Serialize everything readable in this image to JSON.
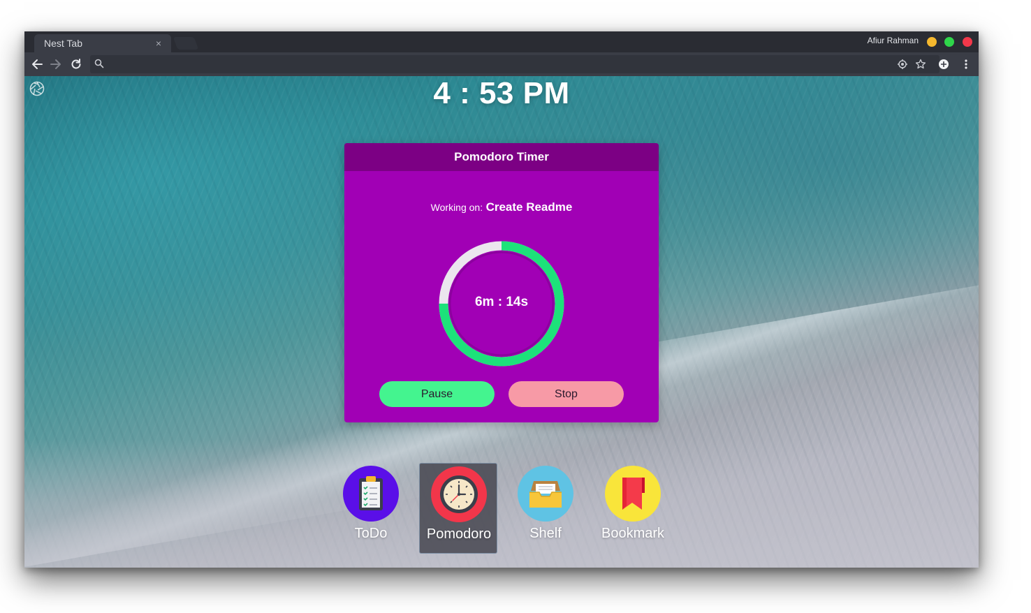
{
  "browser": {
    "tab_title": "Nest Tab",
    "tab_close_glyph": "×",
    "profile_name": "Afiur Rahman",
    "address_value": "",
    "colors": {
      "minimize": "#f5b82e",
      "maximize": "#2fd64a",
      "close": "#f2384a"
    }
  },
  "page": {
    "time": "4 : 53 PM",
    "pomodoro": {
      "title": "Pomodoro Timer",
      "working_label": "Working on:",
      "task": "Create Readme",
      "remaining": "6m : 14s",
      "progress_fraction": 0.75,
      "pause_label": "Pause",
      "stop_label": "Stop",
      "colors": {
        "card": "#a100b5",
        "header": "#7c0084",
        "ring": "#1de27a",
        "pause": "#44f48f",
        "stop": "#f79aa6"
      }
    },
    "dock": [
      {
        "label": "ToDo",
        "icon": "clipboard-checklist-icon",
        "color": "#5a0fe8",
        "active": false
      },
      {
        "label": "Pomodoro",
        "icon": "alarm-clock-icon",
        "color": "#f2364a",
        "active": true
      },
      {
        "label": "Shelf",
        "icon": "inbox-tray-icon",
        "color": "#5fc3e4",
        "active": false
      },
      {
        "label": "Bookmark",
        "icon": "bookmark-icon",
        "color": "#f9e53a",
        "active": false
      }
    ]
  }
}
